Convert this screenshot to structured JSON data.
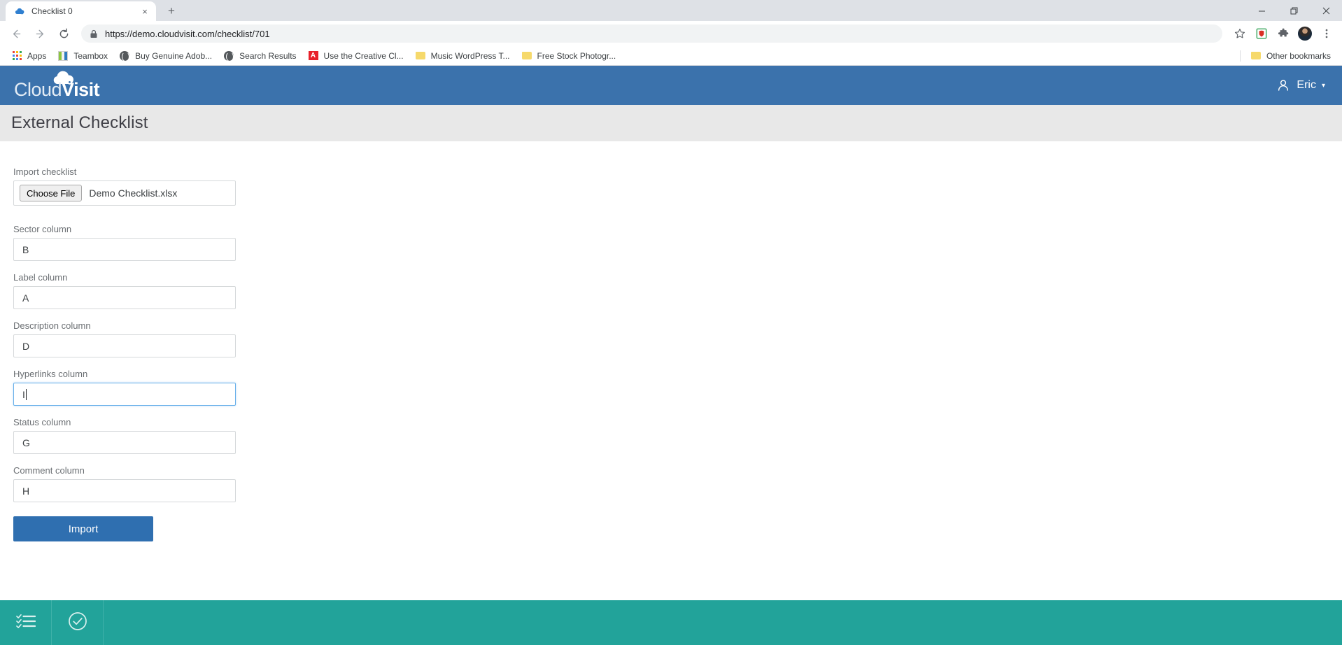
{
  "browser": {
    "tab": {
      "title": "Checklist 0",
      "favicon": "cloud-icon",
      "close": "×"
    },
    "new_tab_label": "+",
    "window_controls": {
      "minimize": "—",
      "maximize": "❐",
      "close": "✕"
    },
    "nav": {
      "back": "←",
      "forward": "→",
      "reload": "⟳"
    },
    "omnibox": {
      "url": "https://demo.cloudvisit.com/checklist/701",
      "lock_icon": "lock-icon"
    },
    "toolbar_icons": [
      {
        "name": "bookmark-star-icon",
        "glyph": "☆"
      },
      {
        "name": "extension-shield-icon",
        "glyph": ""
      },
      {
        "name": "extensions-puzzle-icon",
        "glyph": "✦"
      },
      {
        "name": "profile-avatar",
        "glyph": ""
      },
      {
        "name": "chrome-menu-icon",
        "glyph": "⋮"
      }
    ],
    "bookmarks": [
      {
        "label": "Apps",
        "icon": "apps-grid-icon"
      },
      {
        "label": "Teambox",
        "icon": "teambox-icon"
      },
      {
        "label": "Buy Genuine Adob...",
        "icon": "globe-icon"
      },
      {
        "label": "Search Results",
        "icon": "globe-icon"
      },
      {
        "label": "Use the Creative Cl...",
        "icon": "adobe-icon"
      },
      {
        "label": "Music WordPress T...",
        "icon": "folder-icon"
      },
      {
        "label": "Free Stock Photogr...",
        "icon": "folder-icon"
      }
    ],
    "other_bookmarks": {
      "label": "Other bookmarks",
      "icon": "folder-icon"
    }
  },
  "app": {
    "header": {
      "logo_light": "Cloud",
      "logo_bold": "Visit",
      "logo_cloud_icon": "cloud-icon",
      "user_name": "Eric",
      "user_icon": "person-icon",
      "caret": "▾"
    },
    "page_title": "External Checklist",
    "form": {
      "import_label": "Import checklist",
      "choose_file_label": "Choose File",
      "file_name": "Demo Checklist.xlsx",
      "fields": [
        {
          "label": "Sector column",
          "value": "B",
          "focused": false
        },
        {
          "label": "Label column",
          "value": "A",
          "focused": false
        },
        {
          "label": "Description column",
          "value": "D",
          "focused": false
        },
        {
          "label": "Hyperlinks column",
          "value": "I",
          "focused": true
        },
        {
          "label": "Status column",
          "value": "G",
          "focused": false
        },
        {
          "label": "Comment column",
          "value": "H",
          "focused": false
        }
      ],
      "submit_label": "Import"
    },
    "bottom_bar": {
      "items": [
        {
          "name": "checklist-icon"
        },
        {
          "name": "check-circle-icon"
        }
      ]
    }
  },
  "colors": {
    "brand_blue": "#3b72ac",
    "button_blue": "#2f6fb0",
    "teal_bar": "#22a39a",
    "title_bg": "#e8e8e8",
    "focus_border": "#66afe9"
  }
}
